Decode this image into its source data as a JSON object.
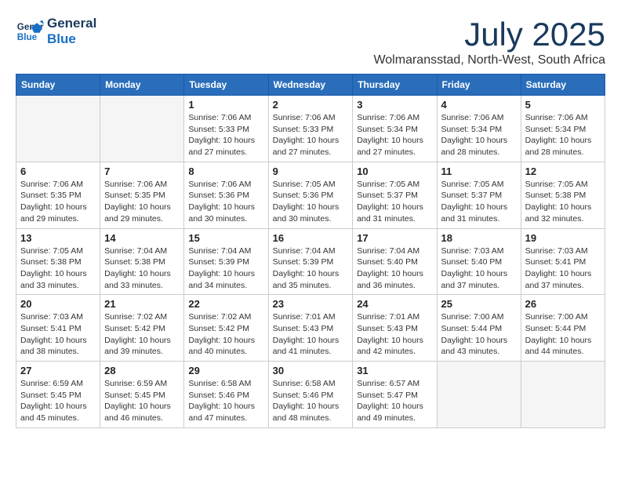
{
  "header": {
    "logo_line1": "General",
    "logo_line2": "Blue",
    "month": "July 2025",
    "location": "Wolmaransstad, North-West, South Africa"
  },
  "days_of_week": [
    "Sunday",
    "Monday",
    "Tuesday",
    "Wednesday",
    "Thursday",
    "Friday",
    "Saturday"
  ],
  "weeks": [
    [
      {
        "day": "",
        "info": ""
      },
      {
        "day": "",
        "info": ""
      },
      {
        "day": "1",
        "info": "Sunrise: 7:06 AM\nSunset: 5:33 PM\nDaylight: 10 hours\nand 27 minutes."
      },
      {
        "day": "2",
        "info": "Sunrise: 7:06 AM\nSunset: 5:33 PM\nDaylight: 10 hours\nand 27 minutes."
      },
      {
        "day": "3",
        "info": "Sunrise: 7:06 AM\nSunset: 5:34 PM\nDaylight: 10 hours\nand 27 minutes."
      },
      {
        "day": "4",
        "info": "Sunrise: 7:06 AM\nSunset: 5:34 PM\nDaylight: 10 hours\nand 28 minutes."
      },
      {
        "day": "5",
        "info": "Sunrise: 7:06 AM\nSunset: 5:34 PM\nDaylight: 10 hours\nand 28 minutes."
      }
    ],
    [
      {
        "day": "6",
        "info": "Sunrise: 7:06 AM\nSunset: 5:35 PM\nDaylight: 10 hours\nand 29 minutes."
      },
      {
        "day": "7",
        "info": "Sunrise: 7:06 AM\nSunset: 5:35 PM\nDaylight: 10 hours\nand 29 minutes."
      },
      {
        "day": "8",
        "info": "Sunrise: 7:06 AM\nSunset: 5:36 PM\nDaylight: 10 hours\nand 30 minutes."
      },
      {
        "day": "9",
        "info": "Sunrise: 7:05 AM\nSunset: 5:36 PM\nDaylight: 10 hours\nand 30 minutes."
      },
      {
        "day": "10",
        "info": "Sunrise: 7:05 AM\nSunset: 5:37 PM\nDaylight: 10 hours\nand 31 minutes."
      },
      {
        "day": "11",
        "info": "Sunrise: 7:05 AM\nSunset: 5:37 PM\nDaylight: 10 hours\nand 31 minutes."
      },
      {
        "day": "12",
        "info": "Sunrise: 7:05 AM\nSunset: 5:38 PM\nDaylight: 10 hours\nand 32 minutes."
      }
    ],
    [
      {
        "day": "13",
        "info": "Sunrise: 7:05 AM\nSunset: 5:38 PM\nDaylight: 10 hours\nand 33 minutes."
      },
      {
        "day": "14",
        "info": "Sunrise: 7:04 AM\nSunset: 5:38 PM\nDaylight: 10 hours\nand 33 minutes."
      },
      {
        "day": "15",
        "info": "Sunrise: 7:04 AM\nSunset: 5:39 PM\nDaylight: 10 hours\nand 34 minutes."
      },
      {
        "day": "16",
        "info": "Sunrise: 7:04 AM\nSunset: 5:39 PM\nDaylight: 10 hours\nand 35 minutes."
      },
      {
        "day": "17",
        "info": "Sunrise: 7:04 AM\nSunset: 5:40 PM\nDaylight: 10 hours\nand 36 minutes."
      },
      {
        "day": "18",
        "info": "Sunrise: 7:03 AM\nSunset: 5:40 PM\nDaylight: 10 hours\nand 37 minutes."
      },
      {
        "day": "19",
        "info": "Sunrise: 7:03 AM\nSunset: 5:41 PM\nDaylight: 10 hours\nand 37 minutes."
      }
    ],
    [
      {
        "day": "20",
        "info": "Sunrise: 7:03 AM\nSunset: 5:41 PM\nDaylight: 10 hours\nand 38 minutes."
      },
      {
        "day": "21",
        "info": "Sunrise: 7:02 AM\nSunset: 5:42 PM\nDaylight: 10 hours\nand 39 minutes."
      },
      {
        "day": "22",
        "info": "Sunrise: 7:02 AM\nSunset: 5:42 PM\nDaylight: 10 hours\nand 40 minutes."
      },
      {
        "day": "23",
        "info": "Sunrise: 7:01 AM\nSunset: 5:43 PM\nDaylight: 10 hours\nand 41 minutes."
      },
      {
        "day": "24",
        "info": "Sunrise: 7:01 AM\nSunset: 5:43 PM\nDaylight: 10 hours\nand 42 minutes."
      },
      {
        "day": "25",
        "info": "Sunrise: 7:00 AM\nSunset: 5:44 PM\nDaylight: 10 hours\nand 43 minutes."
      },
      {
        "day": "26",
        "info": "Sunrise: 7:00 AM\nSunset: 5:44 PM\nDaylight: 10 hours\nand 44 minutes."
      }
    ],
    [
      {
        "day": "27",
        "info": "Sunrise: 6:59 AM\nSunset: 5:45 PM\nDaylight: 10 hours\nand 45 minutes."
      },
      {
        "day": "28",
        "info": "Sunrise: 6:59 AM\nSunset: 5:45 PM\nDaylight: 10 hours\nand 46 minutes."
      },
      {
        "day": "29",
        "info": "Sunrise: 6:58 AM\nSunset: 5:46 PM\nDaylight: 10 hours\nand 47 minutes."
      },
      {
        "day": "30",
        "info": "Sunrise: 6:58 AM\nSunset: 5:46 PM\nDaylight: 10 hours\nand 48 minutes."
      },
      {
        "day": "31",
        "info": "Sunrise: 6:57 AM\nSunset: 5:47 PM\nDaylight: 10 hours\nand 49 minutes."
      },
      {
        "day": "",
        "info": ""
      },
      {
        "day": "",
        "info": ""
      }
    ]
  ]
}
